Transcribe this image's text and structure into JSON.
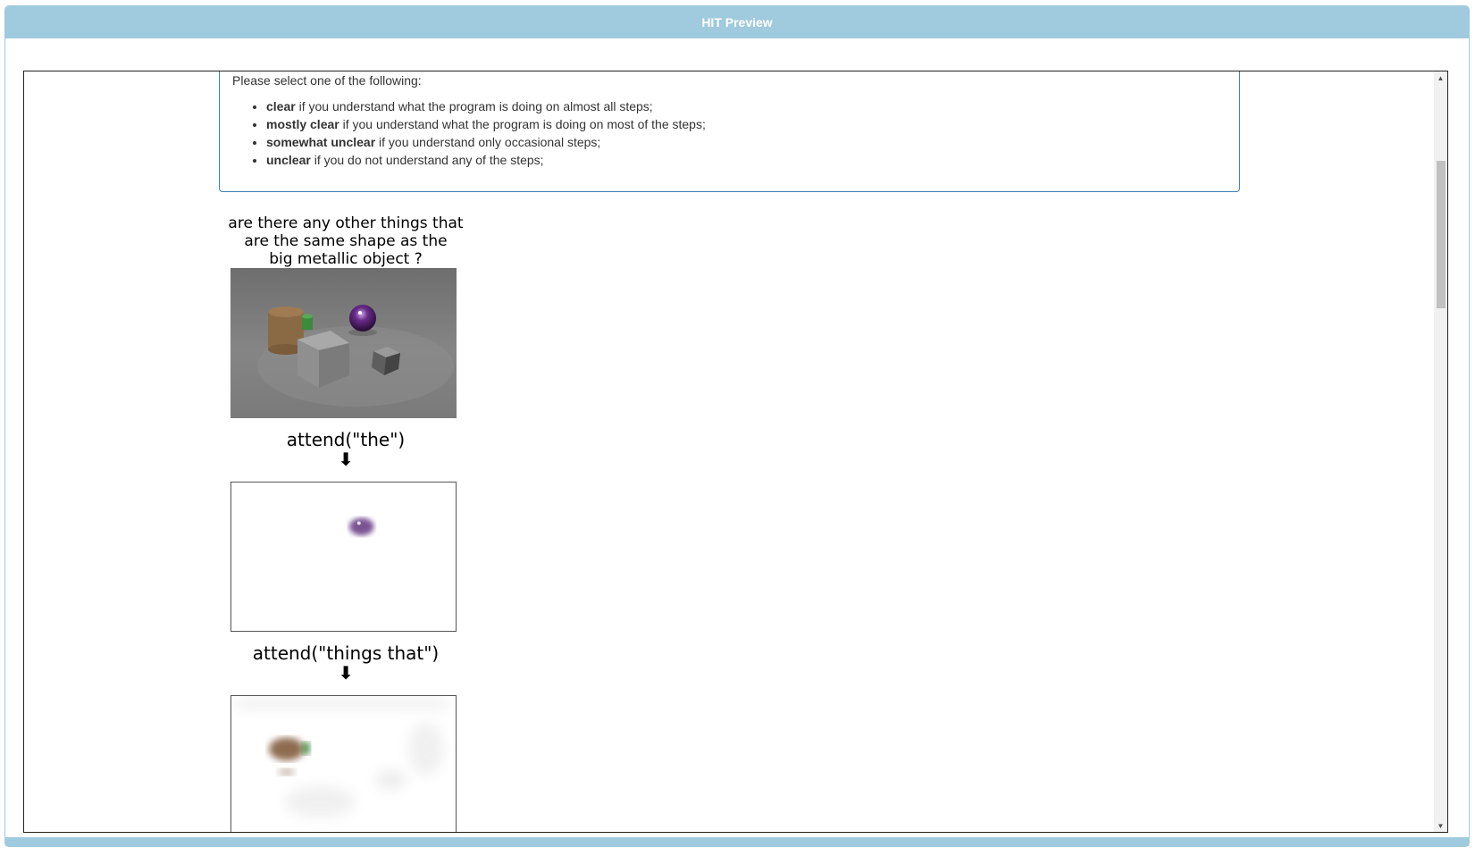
{
  "window": {
    "title": "HIT Preview"
  },
  "instructions": {
    "prompt": "Please select one of the following:",
    "options": [
      {
        "term": "clear",
        "desc": " if you understand what the program is doing on almost all steps;"
      },
      {
        "term": "mostly clear",
        "desc": " if you understand what the program is doing on most of the steps;"
      },
      {
        "term": "somewhat unclear",
        "desc": " if you understand only occasional steps;"
      },
      {
        "term": "unclear",
        "desc": " if you do not understand any of the steps;"
      }
    ]
  },
  "question": {
    "lines": [
      "are there any other things that",
      "are the same shape as the",
      "big metallic object ?"
    ]
  },
  "steps": [
    {
      "title": "attend(\"the\")",
      "arrow": "⬇"
    },
    {
      "title": "attend(\"things that\")",
      "arrow": "⬇"
    }
  ],
  "icons": {
    "scroll_up": "triangle-up-icon",
    "scroll_down": "triangle-down-icon",
    "arrow": "arrow-down-icon"
  }
}
